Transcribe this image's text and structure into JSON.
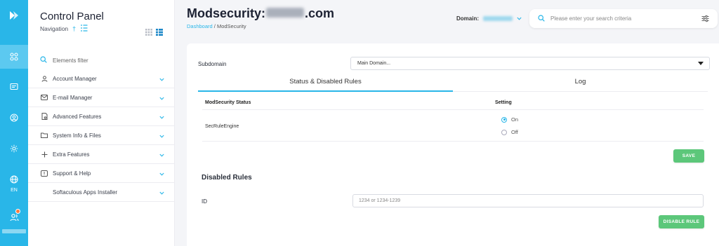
{
  "sidebar": {
    "title": "Control Panel",
    "subtitle": "Navigation",
    "filter_label": "Elements filter",
    "items": [
      {
        "label": "Account Manager",
        "icon": "user-icon"
      },
      {
        "label": "E-mail Manager",
        "icon": "mail-icon"
      },
      {
        "label": "Advanced Features",
        "icon": "settings-doc-icon"
      },
      {
        "label": "System Info & Files",
        "icon": "folder-icon"
      },
      {
        "label": "Extra Features",
        "icon": "plus-icon"
      },
      {
        "label": "Support & Help",
        "icon": "help-icon"
      },
      {
        "label": "Softaculous Apps Installer",
        "icon": ""
      }
    ]
  },
  "rail": {
    "language": "EN"
  },
  "header": {
    "title_prefix": "Modsecurity: ",
    "title_suffix": ".com",
    "breadcrumb_link": "Dashboard",
    "breadcrumb_sep": " / ",
    "breadcrumb_current": "ModSecurity",
    "domain_label": "Domain:",
    "search_placeholder": "Please enter your search criteria"
  },
  "form": {
    "subdomain_label": "Subdomain",
    "subdomain_value": "Main Domain...",
    "tabs": [
      "Status & Disabled Rules",
      "Log"
    ],
    "table_headers": [
      "ModSecurity Status",
      "Setting"
    ],
    "row_label": "SecRuleEngine",
    "options": [
      "On",
      "Off"
    ],
    "selected_option": "On",
    "save_label": "SAVE",
    "disabled_rules_title": "Disabled Rules",
    "id_label": "ID",
    "id_placeholder": "1234 or 1234-1239",
    "disable_rule_label": "DISABLE RULE"
  },
  "colors": {
    "accent": "#29b6e8",
    "button_green": "#5cc77a"
  }
}
